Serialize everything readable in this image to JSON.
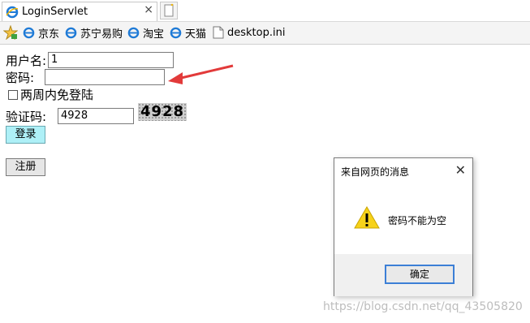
{
  "tab": {
    "title": "LoginServlet",
    "close": "×"
  },
  "favorites": [
    "京东",
    "苏宁易购",
    "淘宝",
    "天猫",
    "desktop.ini"
  ],
  "form": {
    "username_label": "用户名:",
    "username_value": "1",
    "password_label": "密码:",
    "password_value": "",
    "remember_label": "两周内免登陆",
    "captcha_label": "验证码:",
    "captcha_value": "4928",
    "captcha_image_text": "4928",
    "login_button": "登录",
    "register_button": "注册"
  },
  "dialog": {
    "title": "来自网页的消息",
    "close": "✕",
    "message": "密码不能为空",
    "ok_button": "确定"
  },
  "watermark": "https://blog.csdn.net/qq_43505820",
  "colors": {
    "annotation_arrow": "#e23a3a",
    "login_button_bg": "#aef0f7",
    "dialog_focus": "#3c7fd6"
  }
}
